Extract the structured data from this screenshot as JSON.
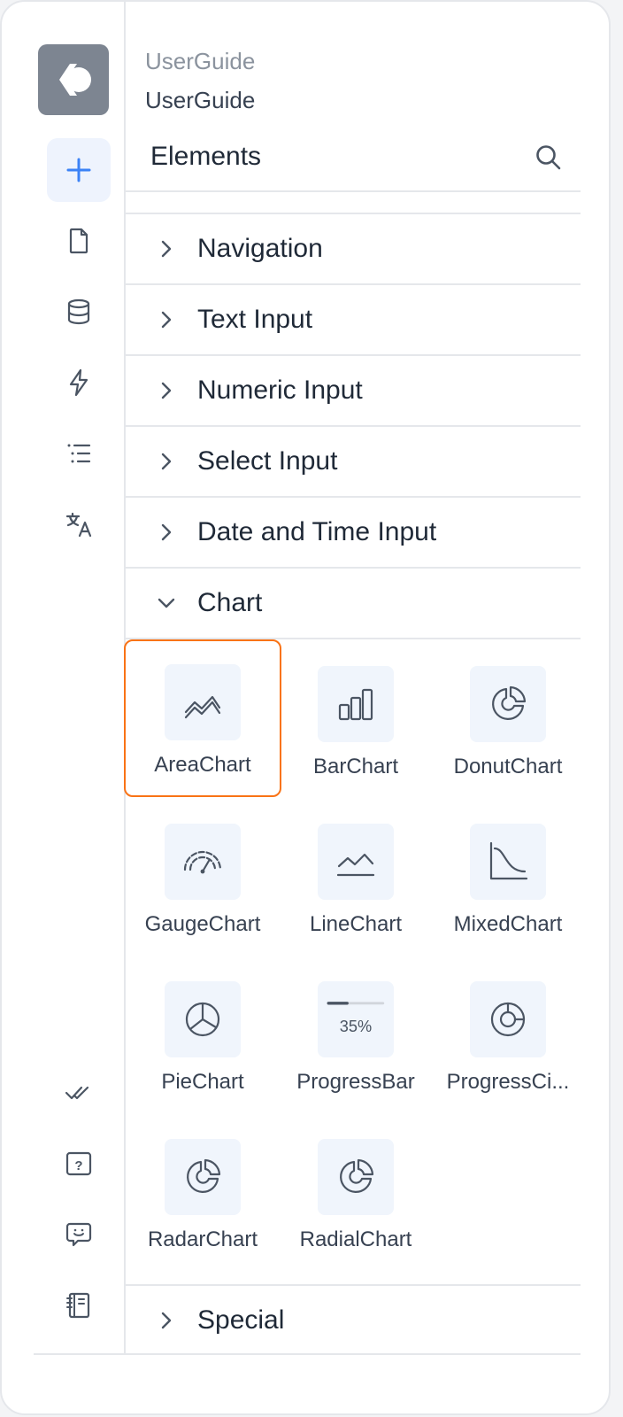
{
  "header": {
    "app_name": "UserGuide",
    "doc_name": "UserGuide",
    "panel_title": "Elements"
  },
  "rail": {
    "top_icons": [
      "add-icon",
      "page-icon",
      "database-icon",
      "lightning-icon",
      "list-icon",
      "translate-icon"
    ],
    "bottom_icons": [
      "double-check-icon",
      "help-icon",
      "feedback-icon",
      "docs-icon"
    ],
    "active_color": "#3b82f6"
  },
  "categories": [
    {
      "label": "Navigation",
      "expanded": false
    },
    {
      "label": "Text Input",
      "expanded": false
    },
    {
      "label": "Numeric Input",
      "expanded": false
    },
    {
      "label": "Select Input",
      "expanded": false
    },
    {
      "label": "Date and Time Input",
      "expanded": false
    },
    {
      "label": "Chart",
      "expanded": true
    },
    {
      "label": "Special",
      "expanded": false
    }
  ],
  "chart_items": [
    {
      "label": "AreaChart",
      "icon": "area-chart-icon",
      "selected": true
    },
    {
      "label": "BarChart",
      "icon": "bar-chart-icon",
      "selected": false
    },
    {
      "label": "DonutChart",
      "icon": "donut-chart-icon",
      "selected": false
    },
    {
      "label": "GaugeChart",
      "icon": "gauge-chart-icon",
      "selected": false
    },
    {
      "label": "LineChart",
      "icon": "line-chart-icon",
      "selected": false
    },
    {
      "label": "MixedChart",
      "icon": "mixed-chart-icon",
      "selected": false
    },
    {
      "label": "PieChart",
      "icon": "pie-chart-icon",
      "selected": false
    },
    {
      "label": "ProgressBar",
      "icon": "progress-bar-icon",
      "selected": false,
      "icon_text": "35%"
    },
    {
      "label": "ProgressCi...",
      "icon": "progress-circle-icon",
      "selected": false
    },
    {
      "label": "RadarChart",
      "icon": "radar-chart-icon",
      "selected": false
    },
    {
      "label": "RadialChart",
      "icon": "radial-chart-icon",
      "selected": false
    }
  ],
  "colors": {
    "selection_border": "#f97316",
    "tile_bg": "#f0f5fc",
    "icon_stroke": "#4b5563"
  }
}
